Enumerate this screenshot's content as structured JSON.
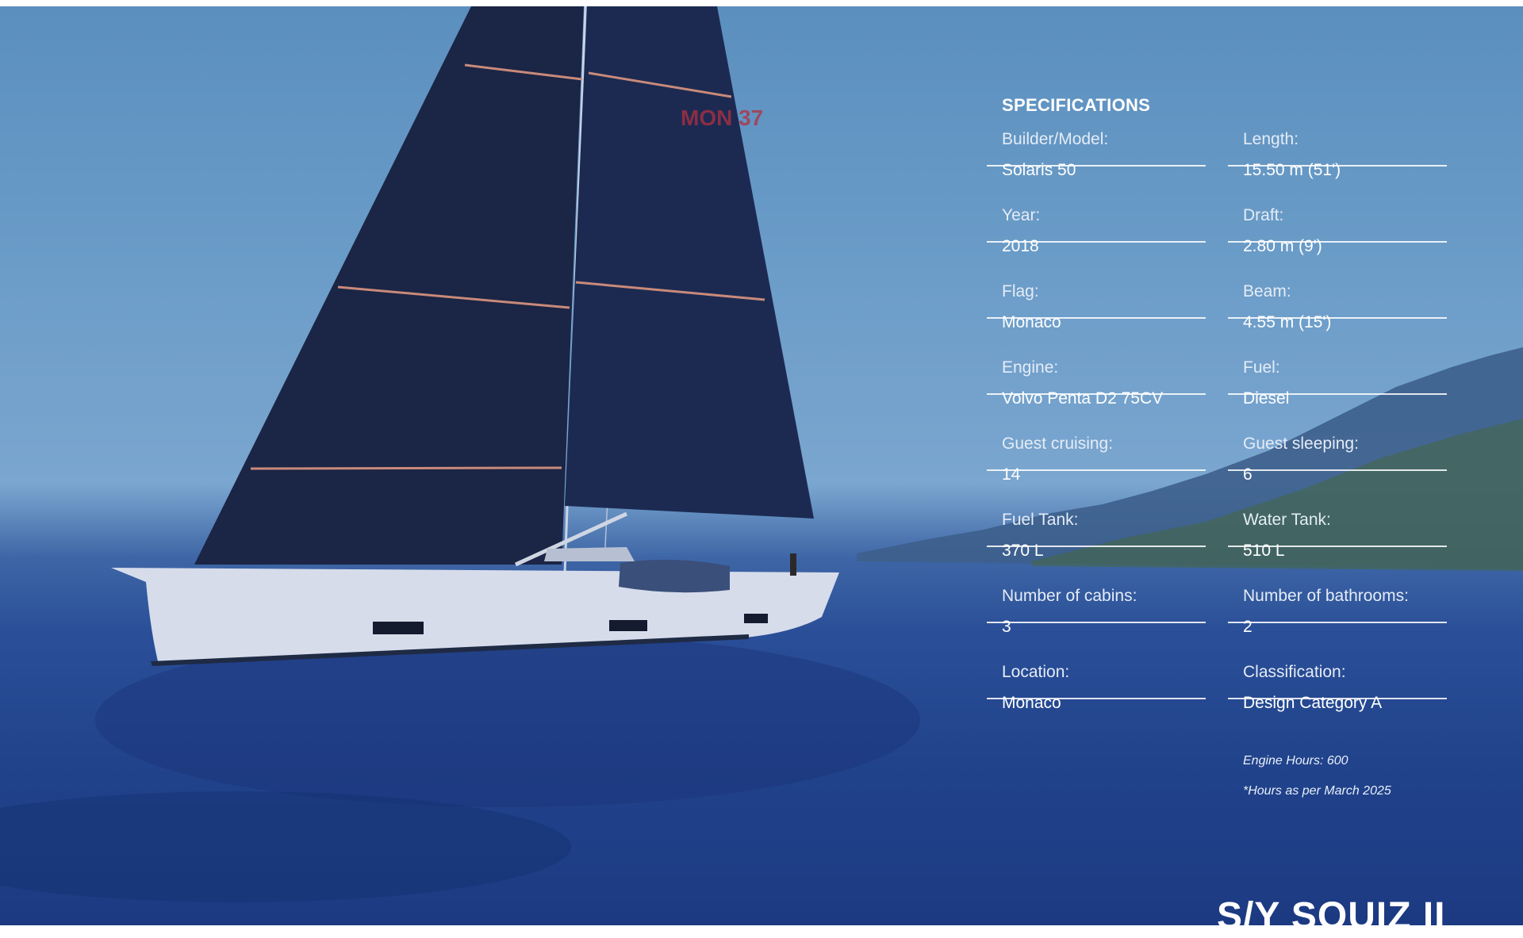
{
  "specs": {
    "heading": "SPECIFICATIONS",
    "items": [
      {
        "label": "Builder/Model:",
        "value": "Solaris 50"
      },
      {
        "label": "Length:",
        "value": "15.50 m (51')"
      },
      {
        "label": "Year:",
        "value": "2018"
      },
      {
        "label": "Draft:",
        "value": "2.80 m (9')"
      },
      {
        "label": "Flag:",
        "value": "Monaco"
      },
      {
        "label": "Beam:",
        "value": "4.55 m (15')"
      },
      {
        "label": "Engine:",
        "value": "Volvo Penta D2 75CV"
      },
      {
        "label": "Fuel:",
        "value": "Diesel"
      },
      {
        "label": "Guest cruising:",
        "value": "14"
      },
      {
        "label": "Guest sleeping:",
        "value": "6"
      },
      {
        "label": "Fuel Tank:",
        "value": "370 L"
      },
      {
        "label": "Water Tank:",
        "value": "510 L"
      },
      {
        "label": "Number of cabins:",
        "value": "3"
      },
      {
        "label": "Number of bathrooms:",
        "value": "2"
      },
      {
        "label": "Location:",
        "value": "Monaco"
      },
      {
        "label": "Classification:",
        "value": "Design Category A"
      }
    ]
  },
  "notes": {
    "engine_hours": "Engine Hours: 600",
    "hours_note": "*Hours as per March 2025"
  },
  "yacht_title": "S/Y SQUIZ II",
  "sail_number": "MON 37",
  "colors": {
    "overlay_blue": "#2a4f98",
    "sky": "#6b9cc8",
    "sail": "#1b2545",
    "hull": "#d6dcea"
  }
}
